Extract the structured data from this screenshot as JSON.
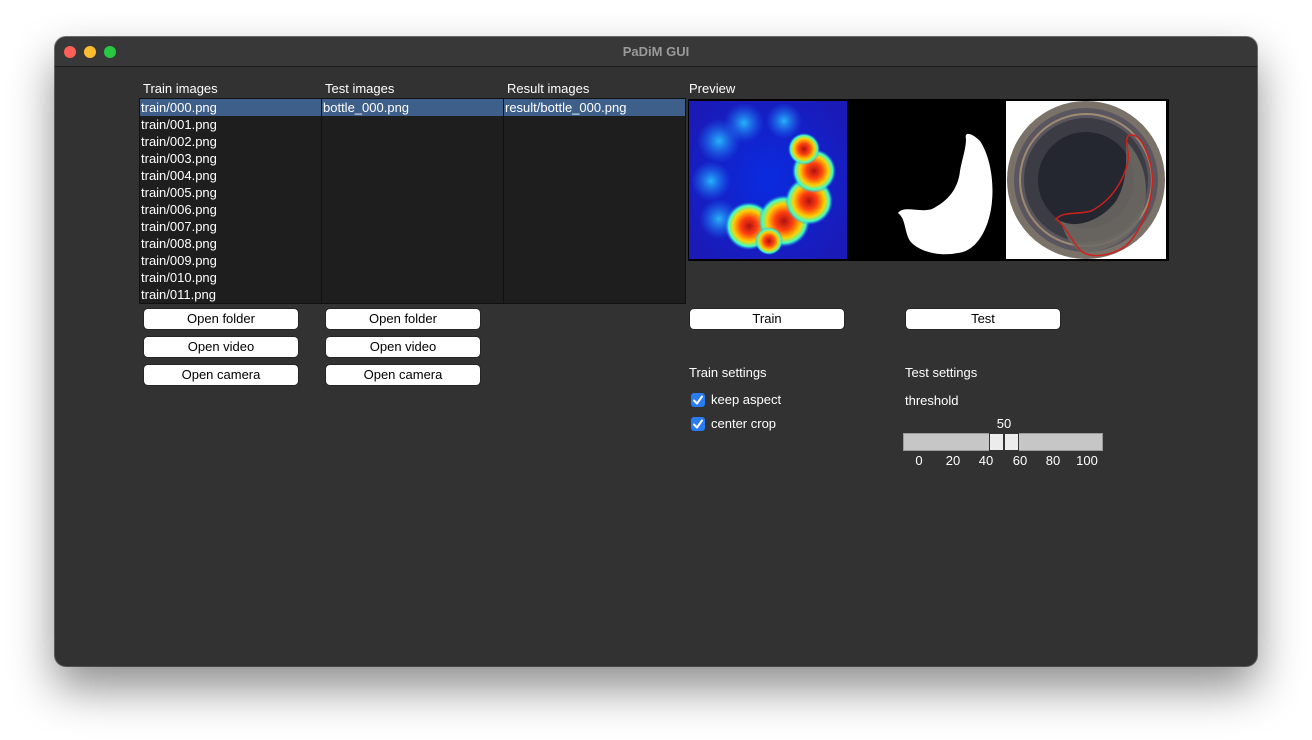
{
  "window": {
    "title": "PaDiM GUI"
  },
  "train": {
    "label": "Train images",
    "items": [
      "train/000.png",
      "train/001.png",
      "train/002.png",
      "train/003.png",
      "train/004.png",
      "train/005.png",
      "train/006.png",
      "train/007.png",
      "train/008.png",
      "train/009.png",
      "train/010.png",
      "train/011.png"
    ],
    "selected_index": 0,
    "buttons": {
      "open_folder": "Open folder",
      "open_video": "Open video",
      "open_camera": "Open camera"
    }
  },
  "test": {
    "label": "Test images",
    "items": [
      "bottle_000.png"
    ],
    "selected_index": 0,
    "buttons": {
      "open_folder": "Open folder",
      "open_video": "Open video",
      "open_camera": "Open camera"
    }
  },
  "result": {
    "label": "Result images",
    "items": [
      "result/bottle_000.png"
    ],
    "selected_index": 0
  },
  "preview": {
    "label": "Preview"
  },
  "actions": {
    "train": "Train",
    "test": "Test"
  },
  "train_settings": {
    "label": "Train settings",
    "keep_aspect": {
      "label": "keep aspect",
      "checked": true
    },
    "center_crop": {
      "label": "center crop",
      "checked": true
    }
  },
  "test_settings": {
    "label": "Test settings",
    "threshold_label": "threshold",
    "threshold_value": "50",
    "slider": {
      "min": 0,
      "max": 100,
      "value": 50
    },
    "ticks": [
      "0",
      "20",
      "40",
      "60",
      "80",
      "100"
    ]
  },
  "colors": {
    "selection": "#3e5f8a",
    "checkbox": "#2a7bf6",
    "window_bg": "#323232"
  }
}
